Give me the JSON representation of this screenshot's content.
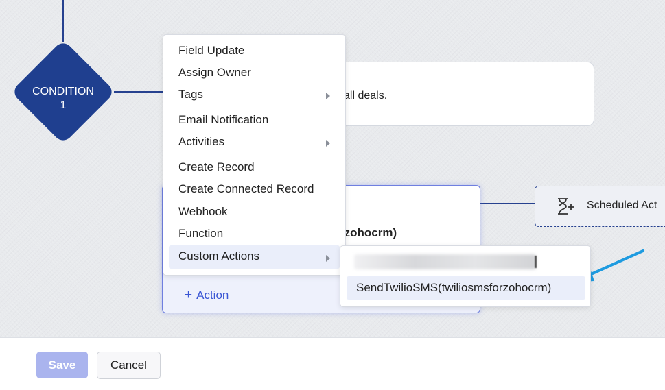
{
  "condition": {
    "label": "CONDITION 1"
  },
  "condition_card": {
    "text": "all deals."
  },
  "action_box": {
    "partial_text": "rzohocrm)",
    "add_action_label": "Action",
    "add_icon": "plus-icon"
  },
  "scheduled": {
    "label": "Scheduled Act",
    "icon": "hourglass-plus-icon"
  },
  "menu": {
    "items": [
      {
        "label": "Field Update",
        "has_submenu": false
      },
      {
        "label": "Assign Owner",
        "has_submenu": false
      },
      {
        "label": "Tags",
        "has_submenu": true
      },
      {
        "label": "Email Notification",
        "has_submenu": false
      },
      {
        "label": "Activities",
        "has_submenu": true
      },
      {
        "label": "Create Record",
        "has_submenu": false
      },
      {
        "label": "Create Connected Record",
        "has_submenu": false
      },
      {
        "label": "Webhook",
        "has_submenu": false
      },
      {
        "label": "Function",
        "has_submenu": false
      },
      {
        "label": "Custom Actions",
        "has_submenu": true,
        "active": true
      }
    ]
  },
  "submenu": {
    "items": [
      {
        "label": "SendTwilioSMS(twiliosmsforzohocrm)"
      }
    ]
  },
  "footer": {
    "save_label": "Save",
    "cancel_label": "Cancel"
  },
  "colors": {
    "accent": "#1f3f8f",
    "link": "#3a56d4",
    "pointer_arrow": "#1e9be0",
    "save_disabled": "#aab4ee"
  }
}
